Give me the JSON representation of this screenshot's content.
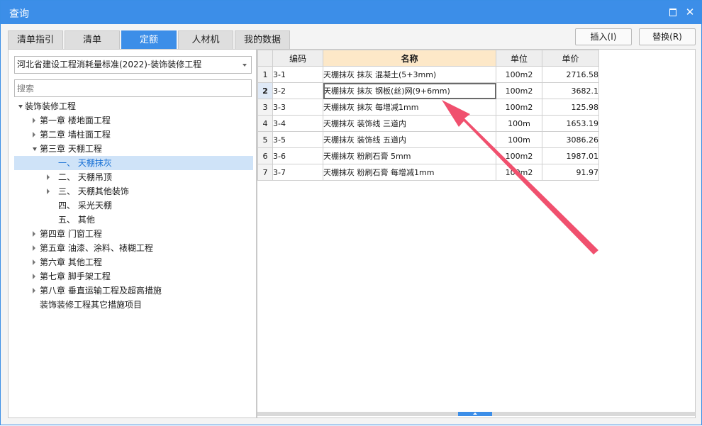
{
  "window": {
    "title": "查询",
    "maximize_icon": "maximize-icon",
    "close_glyph": "✕"
  },
  "tabs": [
    {
      "label": "清单指引",
      "active": false
    },
    {
      "label": "清单",
      "active": false
    },
    {
      "label": "定额",
      "active": true
    },
    {
      "label": "人材机",
      "active": false
    },
    {
      "label": "我的数据",
      "active": false
    }
  ],
  "actions": {
    "insert": "插入(I)",
    "replace": "替换(R)"
  },
  "left": {
    "library": "河北省建设工程消耗量标准(2022)-装饰装修工程",
    "search_placeholder": "搜索",
    "tree": [
      {
        "label": "装饰装修工程",
        "caret": "open"
      },
      {
        "label": "第一章 楼地面工程",
        "caret": "closed"
      },
      {
        "label": "第二章 墙柱面工程",
        "caret": "closed"
      },
      {
        "label": "第三章 天棚工程",
        "caret": "open"
      },
      {
        "label": "一、 天棚抹灰",
        "caret": "none",
        "selected": true
      },
      {
        "label": "二、 天棚吊顶",
        "caret": "closed"
      },
      {
        "label": "三、 天棚其他装饰",
        "caret": "closed"
      },
      {
        "label": "四、 采光天棚",
        "caret": "none"
      },
      {
        "label": "五、 其他",
        "caret": "none"
      },
      {
        "label": "第四章 门窗工程",
        "caret": "closed"
      },
      {
        "label": "第五章 油漆、涂料、裱糊工程",
        "caret": "closed"
      },
      {
        "label": "第六章 其他工程",
        "caret": "closed"
      },
      {
        "label": "第七章 脚手架工程",
        "caret": "closed"
      },
      {
        "label": "第八章 垂直运输工程及超高措施",
        "caret": "closed"
      },
      {
        "label": "装饰装修工程其它措施项目",
        "caret": "none"
      }
    ]
  },
  "grid": {
    "columns": [
      "编码",
      "名称",
      "单位",
      "单价"
    ],
    "rows": [
      {
        "no": "1",
        "code": "3-1",
        "name": "天棚抹灰 抹灰 混凝土(5+3mm)",
        "unit": "100m2",
        "price": "2716.58"
      },
      {
        "no": "2",
        "code": "3-2",
        "name": "天棚抹灰 抹灰 钢板(丝)网(9+6mm)",
        "unit": "100m2",
        "price": "3682.1",
        "current": true
      },
      {
        "no": "3",
        "code": "3-3",
        "name": "天棚抹灰 抹灰 每增减1mm",
        "unit": "100m2",
        "price": "125.98"
      },
      {
        "no": "4",
        "code": "3-4",
        "name": "天棚抹灰 装饰线 三道内",
        "unit": "100m",
        "price": "1653.19"
      },
      {
        "no": "5",
        "code": "3-5",
        "name": "天棚抹灰 装饰线 五道内",
        "unit": "100m",
        "price": "3086.26"
      },
      {
        "no": "6",
        "code": "3-6",
        "name": "天棚抹灰 粉刷石膏 5mm",
        "unit": "100m2",
        "price": "1987.01"
      },
      {
        "no": "7",
        "code": "3-7",
        "name": "天棚抹灰 粉刷石膏 每增减1mm",
        "unit": "100m2",
        "price": "91.97"
      }
    ]
  },
  "annotation": {
    "arrow_color": "#f0506e"
  }
}
